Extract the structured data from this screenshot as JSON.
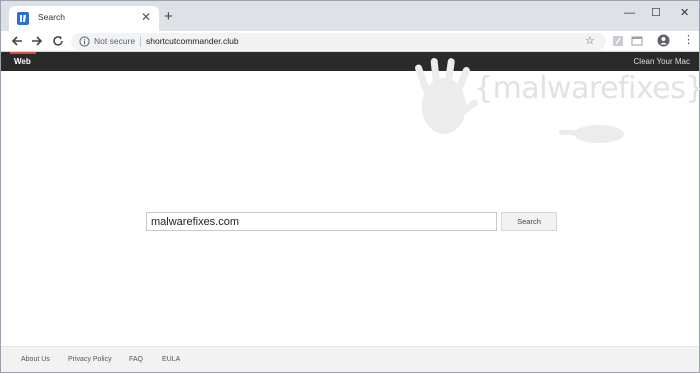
{
  "browser": {
    "tab_title": "Search",
    "tab_close_glyph": "✕",
    "new_tab_glyph": "+",
    "window_controls": {
      "minimize": "—",
      "maximize": "☐",
      "close": "✕"
    },
    "security_label": "Not secure",
    "url": "shortcutcommander.club",
    "menu_glyph": "⋮",
    "star_glyph": "☆"
  },
  "site_nav": {
    "web_label": "Web",
    "clean_label": "Clean Your Mac",
    "accent": "#dd4b39"
  },
  "watermark": {
    "text": "{malwarefixes}"
  },
  "search": {
    "value": "malwarefixes.com",
    "button_label": "Search"
  },
  "footer": {
    "links": [
      "About Us",
      "Privacy Policy",
      "FAQ",
      "EULA"
    ]
  },
  "icons": {
    "back": "back-arrow-icon",
    "forward": "forward-arrow-icon",
    "reload": "reload-icon",
    "info": "info-icon",
    "star": "star-icon",
    "profile": "profile-icon",
    "menu": "menu-dots-icon"
  }
}
